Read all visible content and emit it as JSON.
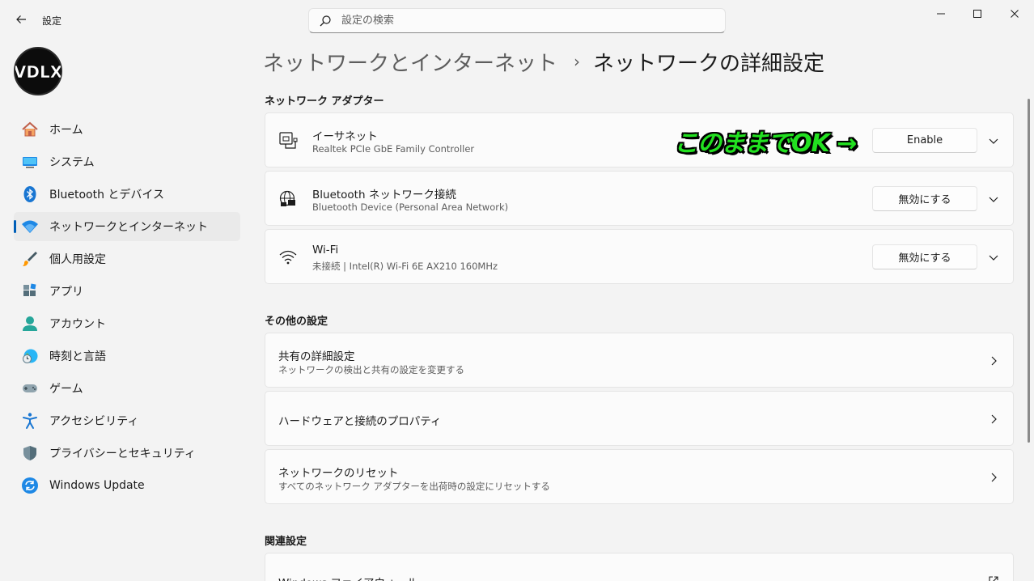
{
  "app": {
    "title": "設定"
  },
  "search": {
    "placeholder": "設定の検索"
  },
  "user": {
    "avatar_text": "VDLX"
  },
  "sidebar": {
    "items": [
      {
        "label": "ホーム",
        "icon": "home-icon"
      },
      {
        "label": "システム",
        "icon": "system-icon"
      },
      {
        "label": "Bluetooth とデバイス",
        "icon": "bluetooth-icon"
      },
      {
        "label": "ネットワークとインターネット",
        "icon": "wifi-icon",
        "active": true
      },
      {
        "label": "個人用設定",
        "icon": "brush-icon"
      },
      {
        "label": "アプリ",
        "icon": "apps-icon"
      },
      {
        "label": "アカウント",
        "icon": "account-icon"
      },
      {
        "label": "時刻と言語",
        "icon": "clock-globe-icon"
      },
      {
        "label": "ゲーム",
        "icon": "gamepad-icon"
      },
      {
        "label": "アクセシビリティ",
        "icon": "accessibility-icon"
      },
      {
        "label": "プライバシーとセキュリティ",
        "icon": "shield-icon"
      },
      {
        "label": "Windows Update",
        "icon": "update-icon"
      }
    ]
  },
  "breadcrumb": {
    "parent": "ネットワークとインターネット",
    "separator": "›",
    "current": "ネットワークの詳細設定"
  },
  "adapters": {
    "title": "ネットワーク アダプター",
    "items": [
      {
        "title": "イーサネット",
        "subtitle": "Realtek PCIe GbE Family Controller",
        "button": "Enable",
        "icon": "ethernet-icon"
      },
      {
        "title": "Bluetooth ネットワーク接続",
        "subtitle": "Bluetooth Device (Personal Area Network)",
        "button": "無効にする",
        "icon": "globe-network-icon"
      },
      {
        "title": "Wi-Fi",
        "subtitle": "未接続 | Intel(R) Wi-Fi 6E AX210 160MHz",
        "button": "無効にする",
        "icon": "wifi-icon"
      }
    ]
  },
  "annotation": {
    "text": "このままでOK →"
  },
  "other": {
    "title": "その他の設定",
    "items": [
      {
        "title": "共有の詳細設定",
        "subtitle": "ネットワークの検出と共有の設定を変更する"
      },
      {
        "title": "ハードウェアと接続のプロパティ",
        "subtitle": ""
      },
      {
        "title": "ネットワークのリセット",
        "subtitle": "すべてのネットワーク アダプターを出荷時の設定にリセットする"
      }
    ]
  },
  "related": {
    "title": "関連設定",
    "items": [
      {
        "title": "Windows ファイアウォール"
      }
    ]
  },
  "colors": {
    "accent": "#005fb8",
    "annotation": "#22e020"
  }
}
